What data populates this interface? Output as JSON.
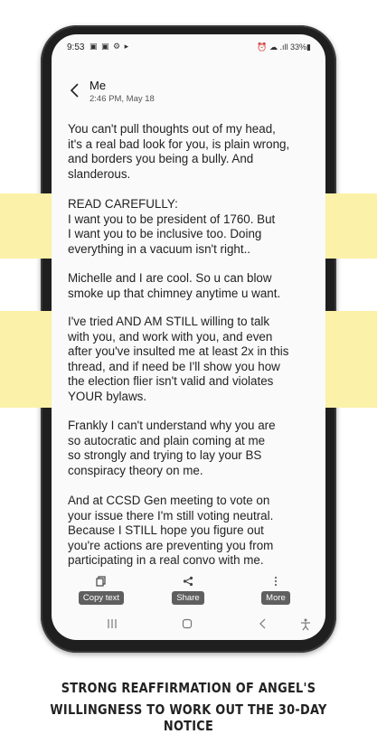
{
  "status_bar": {
    "time": "9:53",
    "notifications": "▣ ▣ ⚙ ▸",
    "right": "⏰ ☁ .ıll 33%▮"
  },
  "header": {
    "title": "Me",
    "subtitle": "2:46 PM, May 18"
  },
  "messages": [
    "You can't pull thoughts out of my head,\nit's a real bad look for you, is plain wrong,\nand borders you being a bully. And\nslanderous.",
    "READ CAREFULLY:\nI want you to be president of 1760. But\nI want you to be inclusive too. Doing\neverything in a vacuum isn't right..",
    "Michelle and I are cool. So u can blow\nsmoke up that chimney anytime u want.",
    "I've tried AND AM STILL willing to talk\nwith you, and work with you, and even\nafter you've insulted me at least 2x in this\nthread, and if need be I'll show you how\nthe election flier isn't valid and violates\nYOUR bylaws.",
    "Frankly I can't understand why you are\nso autocratic and plain coming at me\nso strongly and trying to lay your BS\nconspiracy theory on me.",
    "And at CCSD Gen meeting to vote on\nyour issue there I'm still voting neutral.\nBecause I STILL hope you figure out\nyou're actions are preventing you from\nparticipating in a real convo with me."
  ],
  "actions": {
    "copy": "Copy text",
    "share": "Share",
    "more": "More"
  },
  "caption": {
    "line1": "STRONG REAFFIRMATION OF ANGEL'S",
    "line2": "WILLINGNESS TO WORK OUT THE 30-DAY NOTICE"
  },
  "colors": {
    "highlight": "#fbf1a9",
    "label_bg": "#5f5f5f"
  }
}
